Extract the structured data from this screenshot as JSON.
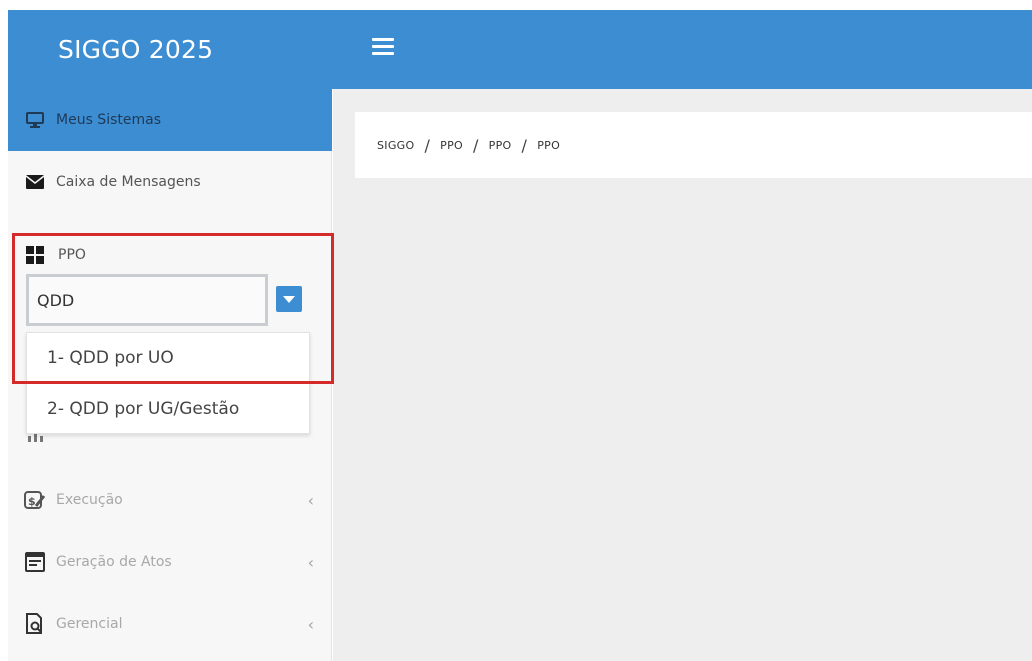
{
  "app": {
    "brand": "SIGGO 2025",
    "colors": {
      "primary": "#3c8dd2",
      "highlight_border": "#d42a2a",
      "main_bg": "#eeeeee"
    }
  },
  "header": {
    "menu_icon": "hamburger-icon"
  },
  "sidebar": {
    "items": [
      {
        "label": "Meus Sistemas",
        "icon": "monitor-icon",
        "active": true
      },
      {
        "label": "Caixa de Mensagens",
        "icon": "envelope-icon",
        "active": false
      },
      {
        "label": "PPO",
        "icon": "grid-icon",
        "active": false
      },
      {
        "label": "Execução",
        "icon": "money-icon",
        "active": false
      },
      {
        "label": "Geração de Atos",
        "icon": "document-window-icon",
        "active": false
      },
      {
        "label": "Gerencial",
        "icon": "document-search-icon",
        "active": false
      }
    ]
  },
  "search": {
    "value": "QDD"
  },
  "dropdown": {
    "options": [
      "1- QDD por UO",
      "2- QDD por UG/Gestão"
    ]
  },
  "breadcrumb": [
    "SIGGO",
    "PPO",
    "PPO",
    "PPO"
  ]
}
